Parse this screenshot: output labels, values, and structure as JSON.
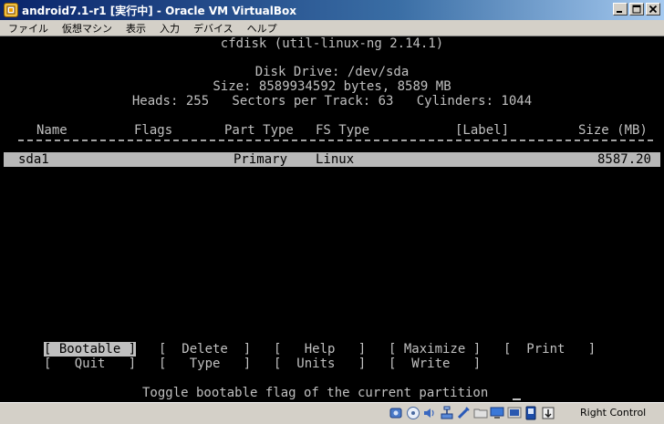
{
  "window": {
    "title": "android7.1-r1 [実行中] - Oracle VM VirtualBox"
  },
  "menu": [
    "ファイル",
    "仮想マシン",
    "表示",
    "入力",
    "デバイス",
    "ヘルプ"
  ],
  "cfdisk": {
    "program_title": "cfdisk (util-linux-ng 2.14.1)",
    "disk_drive": "Disk Drive: /dev/sda",
    "size_line": "Size: 8589934592 bytes, 8589 MB",
    "geometry_line": "Heads: 255   Sectors per Track: 63   Cylinders: 1044",
    "columns": {
      "name": "Name",
      "flags": "Flags",
      "part_type": "Part Type",
      "fs_type": "FS Type",
      "label": "[Label]",
      "size": "Size (MB)"
    },
    "partitions": [
      {
        "name": "sda1",
        "flags": "",
        "part_type": "Primary",
        "fs_type": "Linux",
        "label": "",
        "size": "8587.20"
      }
    ],
    "commands": {
      "bootable": "[ Bootable ]",
      "delete": "[  Delete  ]",
      "help": "[   Help   ]",
      "maximize": "[ Maximize ]",
      "print": "[  Print   ]",
      "quit": "[   Quit   ]",
      "type": "[   Type   ]",
      "units": "[  Units   ]",
      "write": "[  Write   ]"
    },
    "selected_command": "bootable",
    "status_text": "Toggle bootable flag of the current partition"
  },
  "statusbar": {
    "host_key": "Right Control",
    "icons": [
      "hard-disk-icon",
      "optical-disc-icon",
      "audio-icon",
      "network-icon",
      "usb-icon",
      "shared-folder-icon",
      "display-icon",
      "video-capture-icon",
      "virtualization-icon",
      "mouse-integration-icon"
    ]
  }
}
